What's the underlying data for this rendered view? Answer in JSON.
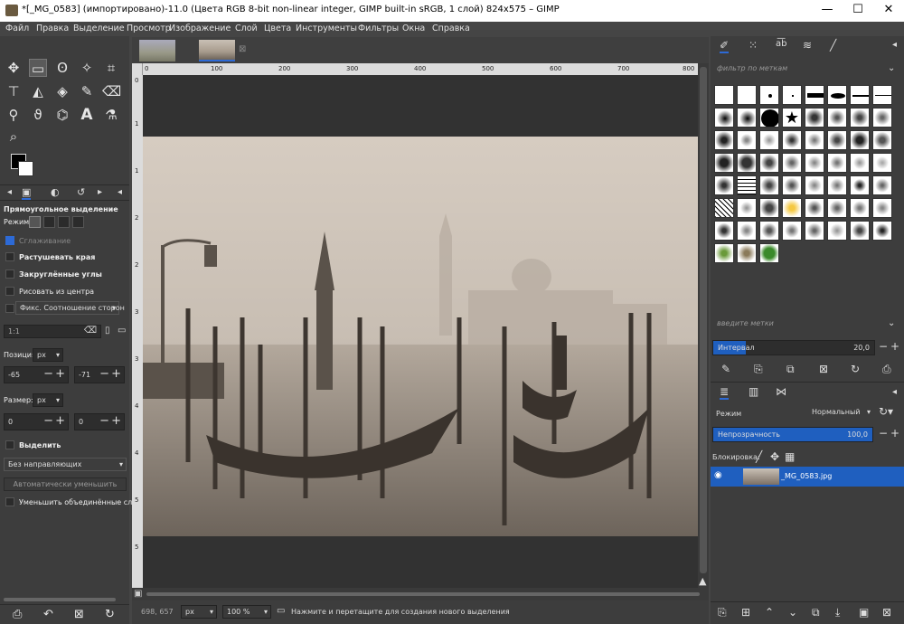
{
  "window": {
    "title": "*[_MG_0583] (импортировано)-11.0 (Цвета RGB 8-bit non-linear integer, GIMP built-in sRGB, 1 слой) 824x575 – GIMP",
    "minimize": "—",
    "maximize": "☐",
    "close": "✕"
  },
  "menu": [
    "Файл",
    "Правка",
    "Выделение",
    "Просмотр",
    "Изображение",
    "Слой",
    "Цвета",
    "Инструменты",
    "Фильтры",
    "Окна",
    "Справка"
  ],
  "tool_options": {
    "title": "Прямоугольное выделение",
    "mode_label": "Режим:",
    "antialias": "Сглаживание",
    "feather": "Растушевать края",
    "rounded": "Закруглённые углы",
    "from_center": "Рисовать из центра",
    "fixed": "Фикс. Соотношение сторон",
    "ratio_value": "1:1",
    "position_label": "Позиция:",
    "unit": "px",
    "pos_x": "-65",
    "pos_y": "-71",
    "size_label": "Размер:",
    "size_w": "0",
    "size_h": "0",
    "highlight": "Выделить",
    "guides": "Без направляющих",
    "auto_shrink": "Автоматически уменьшить",
    "merged": "Уменьшить объединённые слои"
  },
  "ruler": {
    "top": [
      "0",
      "100",
      "200",
      "300",
      "400",
      "500",
      "600",
      "700",
      "800"
    ],
    "left": [
      "0",
      "1",
      "1",
      "2",
      "2",
      "3",
      "3",
      "4",
      "4",
      "5",
      "5"
    ]
  },
  "status": {
    "coords": "698, 657",
    "unit": "px",
    "zoom": "100 %",
    "message": "Нажмите и перетащите для создания нового выделения"
  },
  "brushes": {
    "filter_placeholder": "фильтр по меткам",
    "tags_placeholder": "введите метки",
    "interval_label": "Интервал",
    "interval_value": "20,0",
    "interval_fraction": 0.2
  },
  "layers": {
    "mode_label": "Режим",
    "mode_value": "Нормальный",
    "opacity_label": "Непрозрачность",
    "opacity_value": "100,0",
    "lock_label": "Блокировка:",
    "layer_name": "_MG_0583.jpg"
  }
}
